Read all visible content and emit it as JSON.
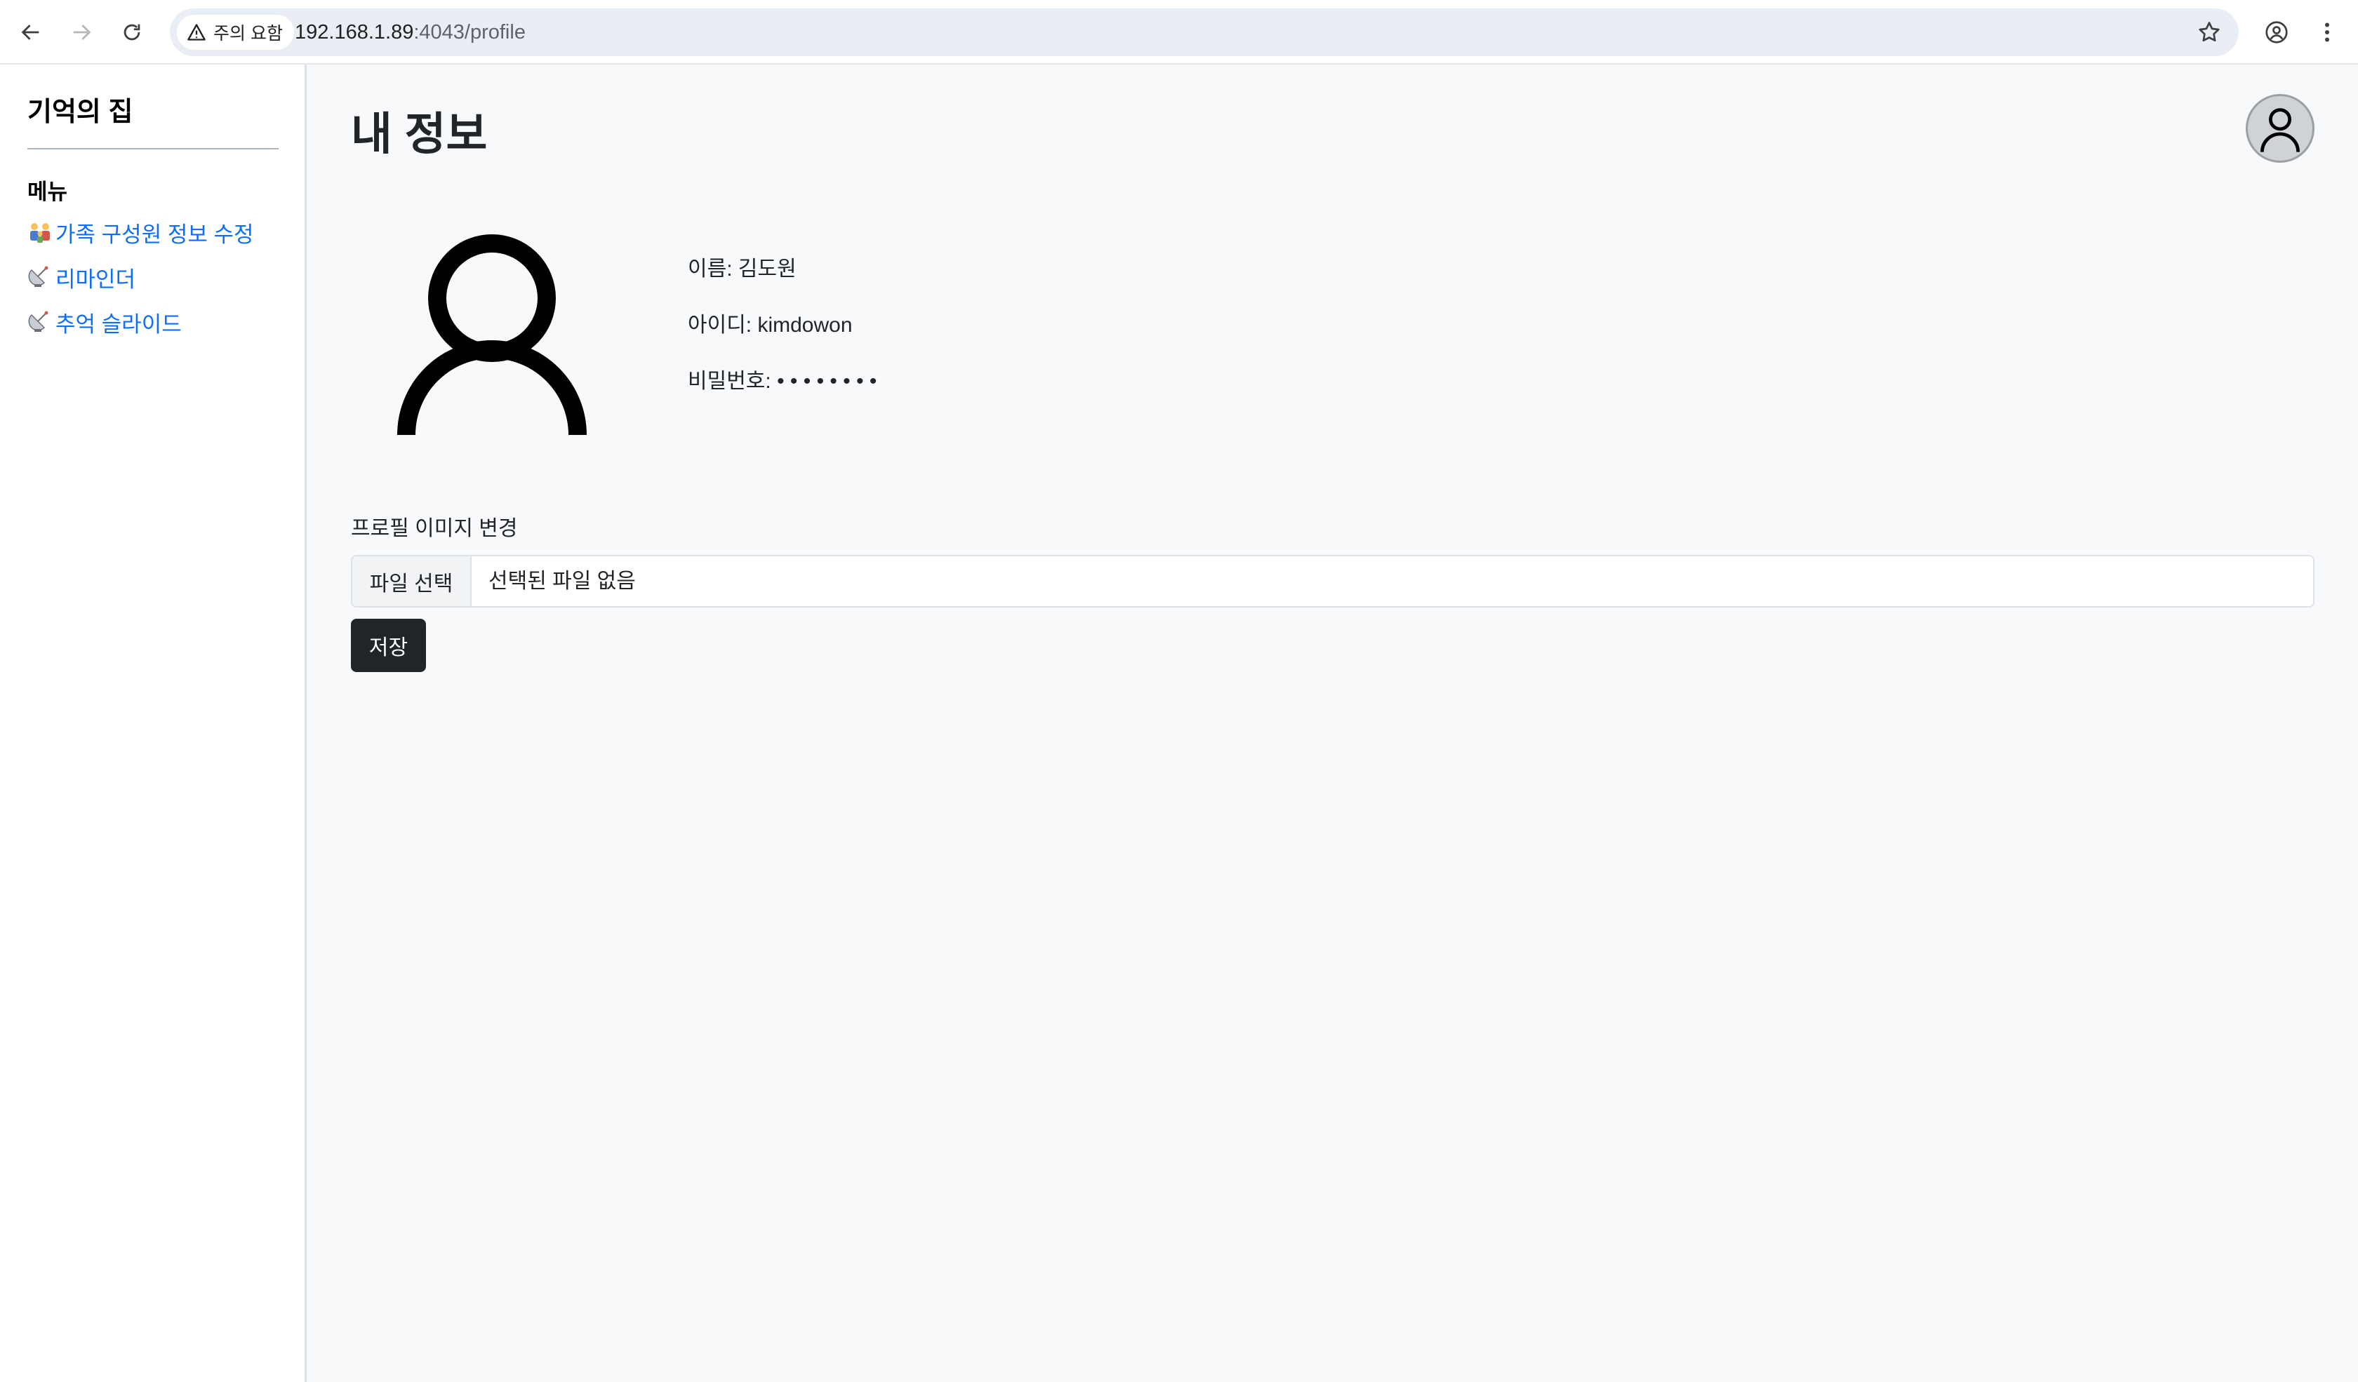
{
  "browser": {
    "security_chip": "주의 요함",
    "url_host": "192.168.1.89",
    "url_rest": ":4043/profile"
  },
  "sidebar": {
    "brand": "기억의 집",
    "menu_title": "메뉴",
    "items": [
      {
        "label": "가족 구성원 정보 수정",
        "icon": "family-emoji-icon"
      },
      {
        "label": "리마인더",
        "icon": "satellite-dish-emoji-icon"
      },
      {
        "label": "추억 슬라이드",
        "icon": "satellite-dish-emoji-icon"
      }
    ]
  },
  "main": {
    "title": "내 정보",
    "profile": {
      "name": "이름: 김도원",
      "id": "아이디: kimdowon",
      "password": "비밀번호: • • • • • • • •"
    },
    "image_section_label": "프로필 이미지 변경",
    "file_button": "파일 선택",
    "file_status": "선택된 파일 없음",
    "save_button": "저장"
  },
  "colors": {
    "link": "#0d6efd",
    "button_dark": "#212529",
    "background": "#f8f9fa"
  }
}
